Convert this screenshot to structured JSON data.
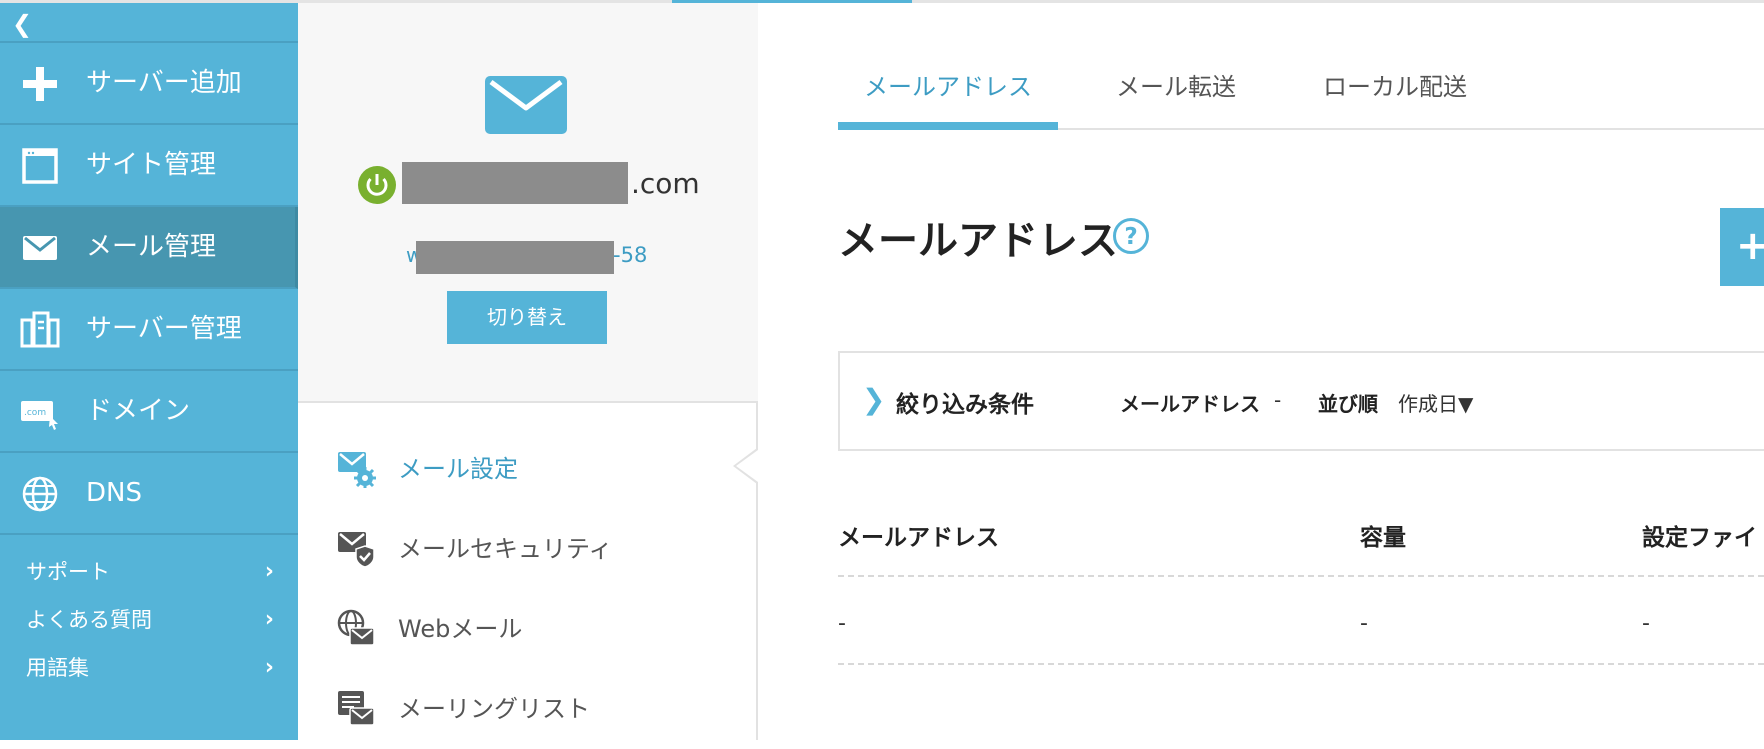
{
  "sidebar": {
    "collapse_glyph": "❮",
    "items": [
      {
        "label": "サーバー追加",
        "icon": "plus-icon"
      },
      {
        "label": "サイト管理",
        "icon": "window-icon"
      },
      {
        "label": "メール管理",
        "icon": "mail-icon",
        "active": true
      },
      {
        "label": "サーバー管理",
        "icon": "server-icon"
      },
      {
        "label": "ドメイン",
        "icon": "domain-icon"
      },
      {
        "label": "DNS",
        "icon": "globe-icon"
      }
    ],
    "support": [
      {
        "label": "サポート"
      },
      {
        "label": "よくある質問"
      },
      {
        "label": "用語集"
      }
    ],
    "chevron": "›"
  },
  "account": {
    "domain_suffix": ".com",
    "id_prefix": "w",
    "id_suffix": "-58",
    "switch_label": "切り替え"
  },
  "submenu": [
    {
      "label": "メール設定",
      "icon": "mail-gear-icon",
      "active": true
    },
    {
      "label": "メールセキュリティ",
      "icon": "mail-shield-icon"
    },
    {
      "label": "Webメール",
      "icon": "globe-mail-icon"
    },
    {
      "label": "メーリングリスト",
      "icon": "list-mail-icon"
    }
  ],
  "main": {
    "tabs": [
      {
        "label": "メールアドレス",
        "active": true
      },
      {
        "label": "メール転送"
      },
      {
        "label": "ローカル配送"
      }
    ],
    "title": "メールアドレス",
    "add_glyph": "+",
    "filter": {
      "chevron": "❯",
      "title": "絞り込み条件",
      "field1_label": "メールアドレス",
      "field1_value": "-",
      "field2_label": "並び順",
      "field2_value": "作成日▼"
    },
    "table": {
      "headers": [
        "メールアドレス",
        "容量",
        "設定ファイ"
      ],
      "rows": [
        [
          "-",
          "-",
          "-"
        ]
      ]
    }
  },
  "colors": {
    "accent": "#55b4d8",
    "sidebar_active": "#4796b0",
    "power_green": "#79b02f",
    "redaction": "#8c8c8c"
  }
}
